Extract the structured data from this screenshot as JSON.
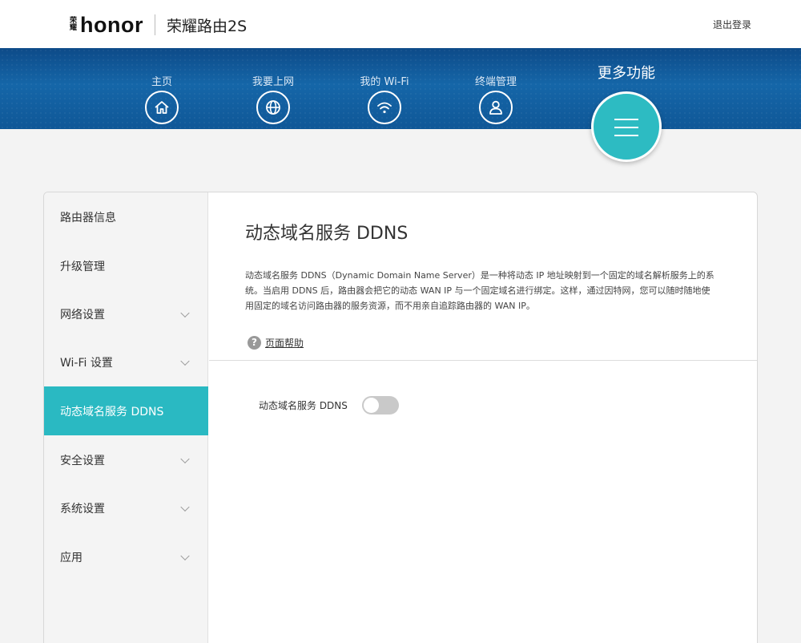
{
  "header": {
    "brand_mark": "荣耀",
    "brand_word": "honor",
    "product": "荣耀路由2S",
    "logout": "退出登录"
  },
  "nav": {
    "items": [
      {
        "label": "主页",
        "icon": "home-icon"
      },
      {
        "label": "我要上网",
        "icon": "globe-icon"
      },
      {
        "label": "我的 Wi-Fi",
        "icon": "wifi-icon"
      },
      {
        "label": "终端管理",
        "icon": "user-icon"
      }
    ],
    "more_label": "更多功能",
    "more_icon": "menu-icon"
  },
  "sidebar": {
    "items": [
      {
        "label": "路由器信息",
        "has_chevron": false,
        "active": false
      },
      {
        "label": "升级管理",
        "has_chevron": false,
        "active": false
      },
      {
        "label": "网络设置",
        "has_chevron": true,
        "active": false
      },
      {
        "label": "Wi-Fi 设置",
        "has_chevron": true,
        "active": false
      },
      {
        "label": "动态域名服务 DDNS",
        "has_chevron": false,
        "active": true
      },
      {
        "label": "安全设置",
        "has_chevron": true,
        "active": false
      },
      {
        "label": "系统设置",
        "has_chevron": true,
        "active": false
      },
      {
        "label": "应用",
        "has_chevron": true,
        "active": false
      }
    ]
  },
  "main": {
    "title": "动态域名服务 DDNS",
    "description_lines": [
      "动态域名服务 DDNS（Dynamic Domain Name Server）是一种将动态 IP 地址映射到一个固定的域名解析服务上的系",
      "统。当启用 DDNS 后，路由器会把它的动态 WAN IP 与一个固定域名进行绑定。这样，通过因特网，您可以随时随地使",
      "用固定的域名访问路由器的服务资源，而不用亲自追踪路由器的 WAN IP。"
    ],
    "help_label": "页面帮助",
    "toggle_label": "动态域名服务 DDNS",
    "toggle_on": false
  },
  "colors": {
    "accent": "#2ab9c2",
    "nav_bg": "#1566a8"
  }
}
